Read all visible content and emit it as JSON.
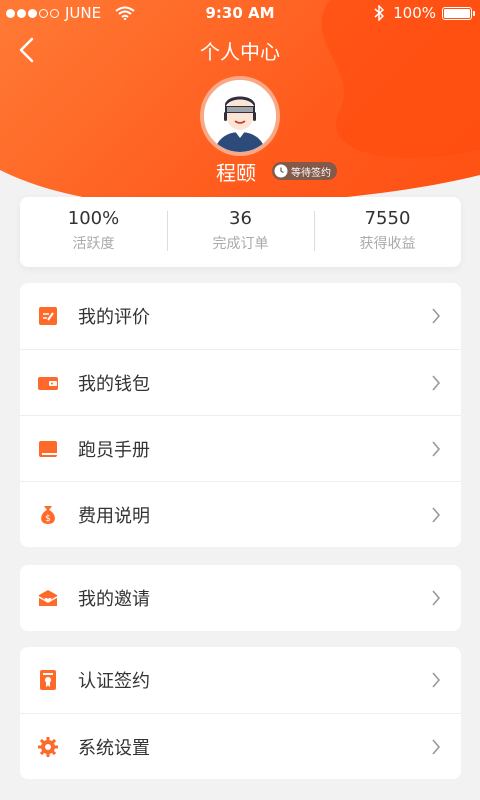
{
  "status_bar": {
    "carrier": "JUNE",
    "time": "9:30 AM",
    "battery_percent": "100%",
    "battery_level": 1.0,
    "signal_filled": 3,
    "signal_total": 5
  },
  "header": {
    "title": "个人中心",
    "accent_color": "#ff5a1c"
  },
  "profile": {
    "name": "程颐",
    "badge": "等待签约"
  },
  "stats": [
    {
      "value": "100%",
      "label": "活跃度"
    },
    {
      "value": "36",
      "label": "完成订单"
    },
    {
      "value": "7550",
      "label": "获得收益"
    }
  ],
  "menu_group_1": [
    {
      "label": "我的评价",
      "icon": "review-icon"
    },
    {
      "label": "我的钱包",
      "icon": "wallet-icon"
    },
    {
      "label": "跑员手册",
      "icon": "book-icon"
    },
    {
      "label": "费用说明",
      "icon": "money-bag-icon"
    }
  ],
  "menu_group_2": [
    {
      "label": "我的邀请",
      "icon": "invite-icon"
    }
  ],
  "menu_group_3": [
    {
      "label": "认证签约",
      "icon": "certificate-icon"
    },
    {
      "label": "系统设置",
      "icon": "settings-icon"
    }
  ]
}
